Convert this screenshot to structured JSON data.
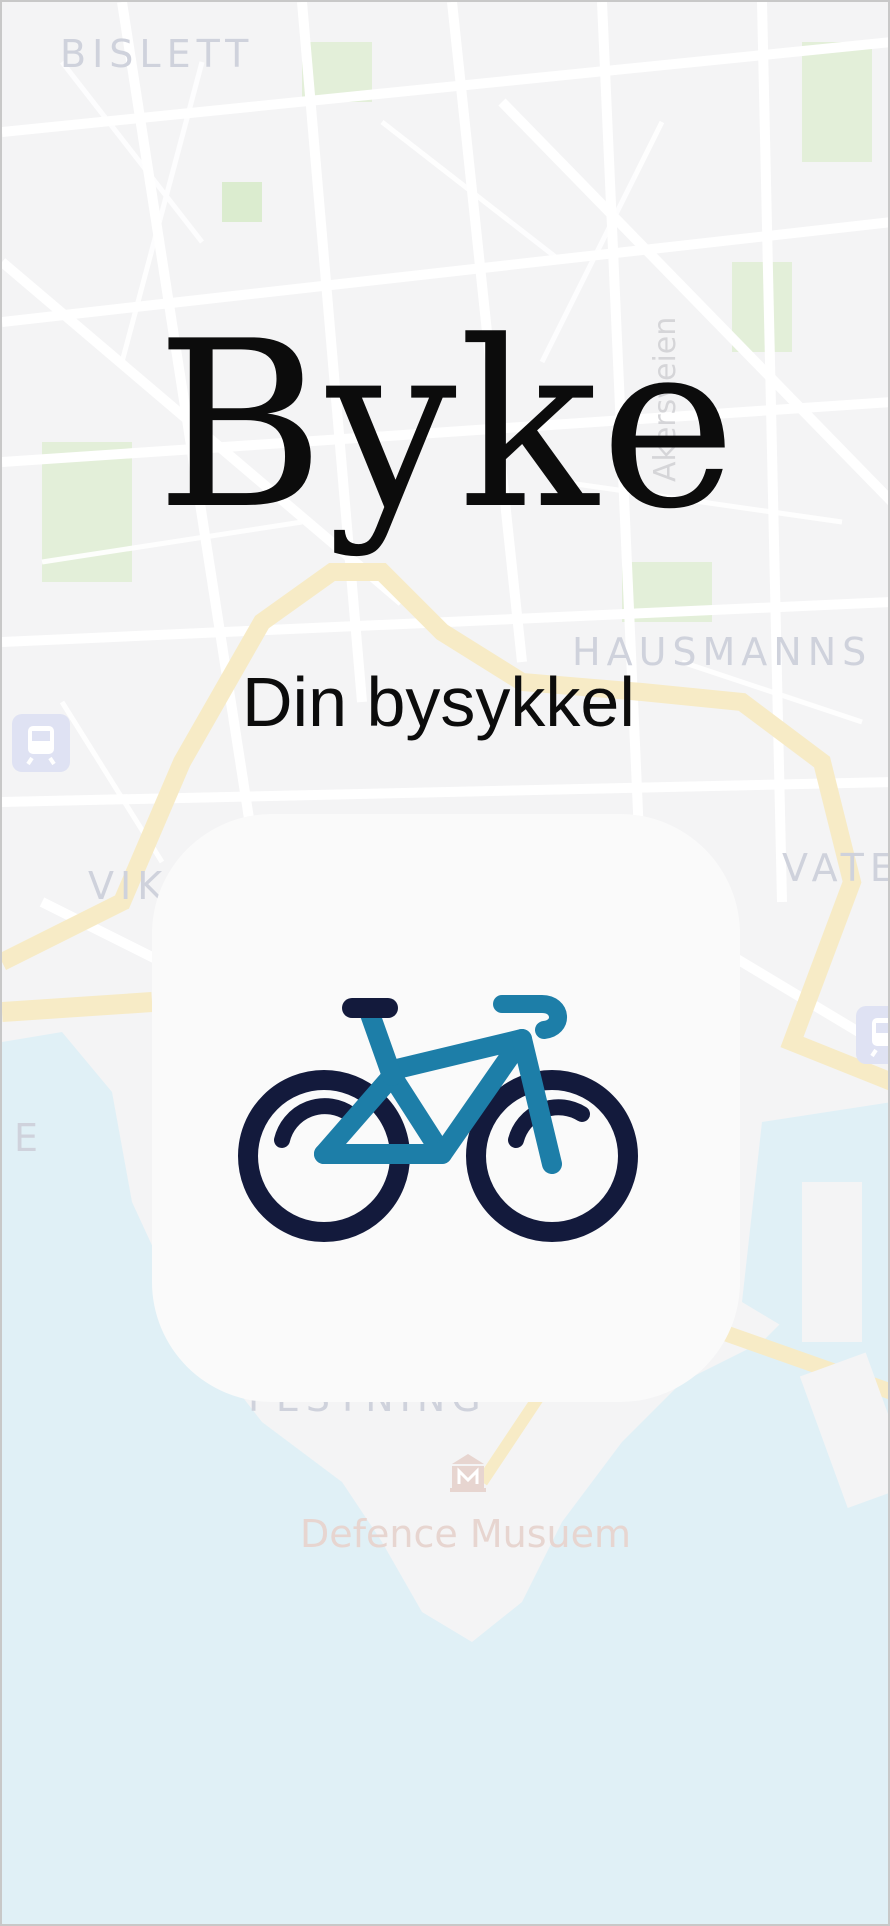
{
  "app": {
    "title": "Byke",
    "subtitle": "Din bysykkel",
    "icon": "bicycle-icon"
  },
  "map": {
    "district_labels": [
      "BISLETT",
      "HAUSMANNS",
      "VIK",
      "VATE",
      "E",
      "FESTNING"
    ],
    "street_label": "Akersveien",
    "poi_label": "Defence Musuem",
    "poi_icon": "museum-icon",
    "transit_icon": "train-station-icon"
  },
  "colors": {
    "title": "#0c0c0c",
    "bike_frame": "#1d7ea8",
    "bike_dark": "#131a3c",
    "water": "#e0f0f6",
    "road_major": "#f7ebc6"
  }
}
